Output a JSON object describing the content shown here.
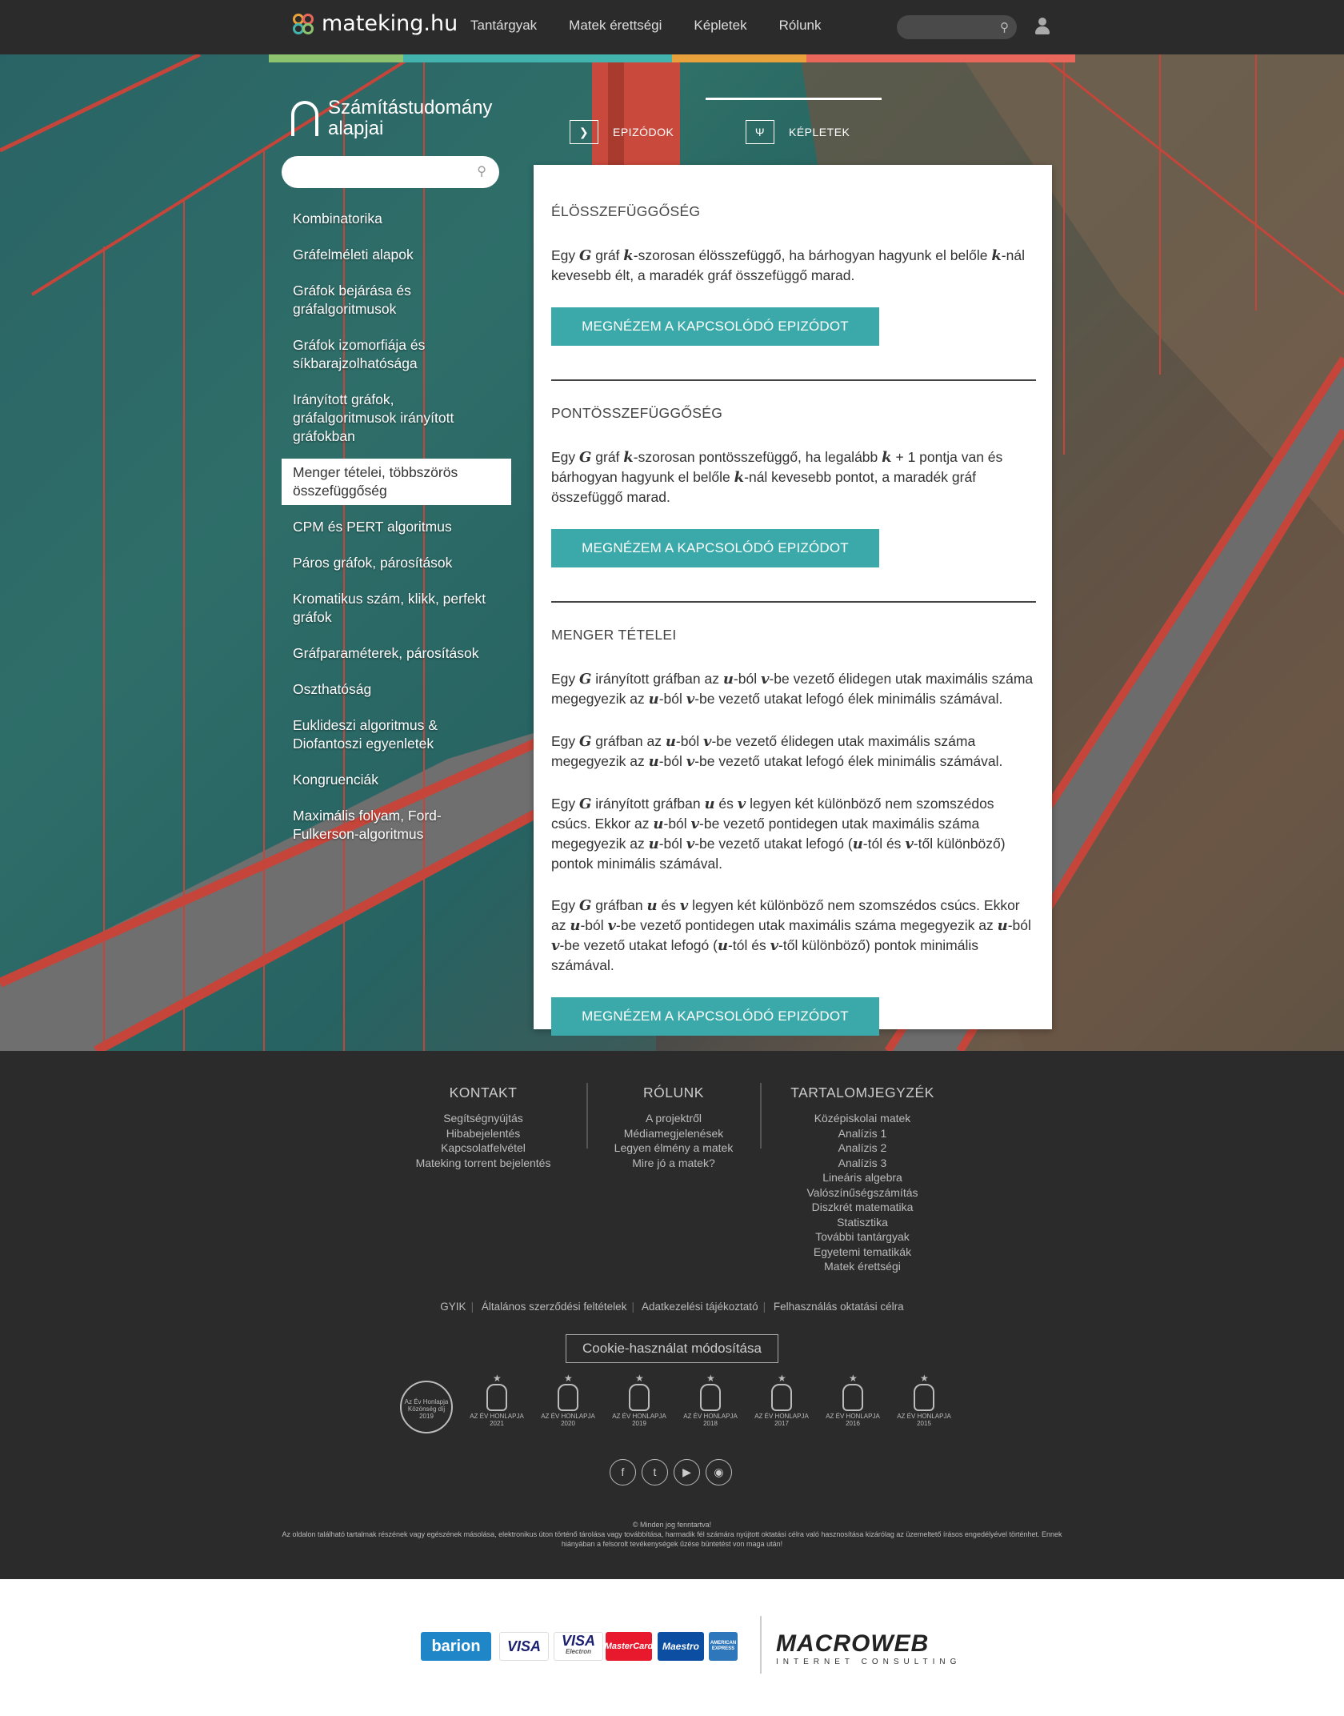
{
  "header": {
    "logo_text": "mateking.hu",
    "nav": [
      "Tantárgyak",
      "Matek érettségi",
      "Képletek",
      "Rólunk"
    ],
    "stripe_colors": [
      "#8dc26f",
      "#43b3ad",
      "#e9a23b",
      "#e8675a"
    ]
  },
  "sidebar": {
    "course_title": "Számítástudomány alapjai",
    "items": [
      "Kombinatorika",
      "Gráfelméleti alapok",
      "Gráfok bejárása és gráfalgoritmusok",
      "Gráfok izomorfiája és síkbarajzolhatósága",
      "Irányított gráfok, gráfalgoritmusok irányított gráfokban",
      "Menger tételei, többszörös összefüggőség",
      "CPM és PERT algoritmus",
      "Páros gráfok, párosítások",
      "Kromatikus szám, klikk, perfekt gráfok",
      "Gráfparaméterek, párosítások",
      "Oszthatóság",
      "Euklideszi algoritmus & Diofantoszi egyenletek",
      "Kongruenciák",
      "Maximális folyam, Ford-Fulkerson-algoritmus"
    ],
    "active_index": 5
  },
  "tabs": {
    "episodes": "EPIZÓDOK",
    "formulas": "KÉPLETEK",
    "episodes_icon": "chevron-right-icon",
    "formulas_icon": "psi-icon"
  },
  "content": {
    "button_label": "MEGNÉZEM A KAPCSOLÓDÓ EPIZÓDOT",
    "s1_title": "ÉLÖSSZEFÜGGŐSÉG",
    "s2_title": "PONTÖSSZEFÜGGŐSÉG",
    "s3_title": "MENGER TÉTELEI"
  },
  "footer": {
    "kontakt": {
      "title": "KONTAKT",
      "links": [
        "Segítségnyújtás",
        "Hibabejelentés",
        "Kapcsolatfelvétel",
        "Mateking torrent bejelentés"
      ]
    },
    "rolunk": {
      "title": "RÓLUNK",
      "links": [
        "A projektről",
        "Médiamegjelenések",
        "Legyen élmény a matek",
        "Mire jó a matek?"
      ]
    },
    "toc": {
      "title": "TARTALOMJEGYZÉK",
      "links": [
        "Középiskolai matek",
        "Analízis 1",
        "Analízis 2",
        "Analízis 3",
        "Lineáris algebra",
        "Valószínűségszámítás",
        "Diszkrét matematika",
        "Statisztika",
        "További tantárgyak",
        "Egyetemi tematikák",
        "Matek érettségi"
      ]
    },
    "legal": [
      "GYIK",
      "Általános szerződési feltételek",
      "Adatkezelési tájékoztató",
      "Felhasználás oktatási célra"
    ],
    "cookie_label": "Cookie-használat módosítása",
    "award_round": [
      "Az Év Honlapja",
      "Közönség díj",
      "2019"
    ],
    "award_label": "AZ ÉV HONLAPJA",
    "award_years": [
      "2021",
      "2020",
      "2019",
      "2018",
      "2017",
      "2016",
      "2015"
    ],
    "social_icons": [
      "facebook-icon",
      "twitter-icon",
      "youtube-icon",
      "instagram-icon"
    ],
    "copyright_1": "© Minden jog fenntartva!",
    "copyright_2": "Az oldalon található tartalmak részének vagy egészének másolása, elektronikus úton történő tárolása vagy továbbítása, harmadik fél számára nyújtott oktatási célra való hasznosítása kizárólag az üzemeltető írásos engedélyével történhet. Ennek hiányában a felsorolt tevékenységek űzése büntetést von maga után!"
  },
  "payments": {
    "barion": "barion",
    "visa": "VISA",
    "visa_electron": "VISA",
    "visa_electron_sub": "Electron",
    "mastercard": "MasterCard",
    "maestro": "Maestro",
    "amex": "AMERICAN EXPRESS",
    "macroweb": "MACROWEB",
    "macroweb_sub": "INTERNET CONSULTING"
  }
}
